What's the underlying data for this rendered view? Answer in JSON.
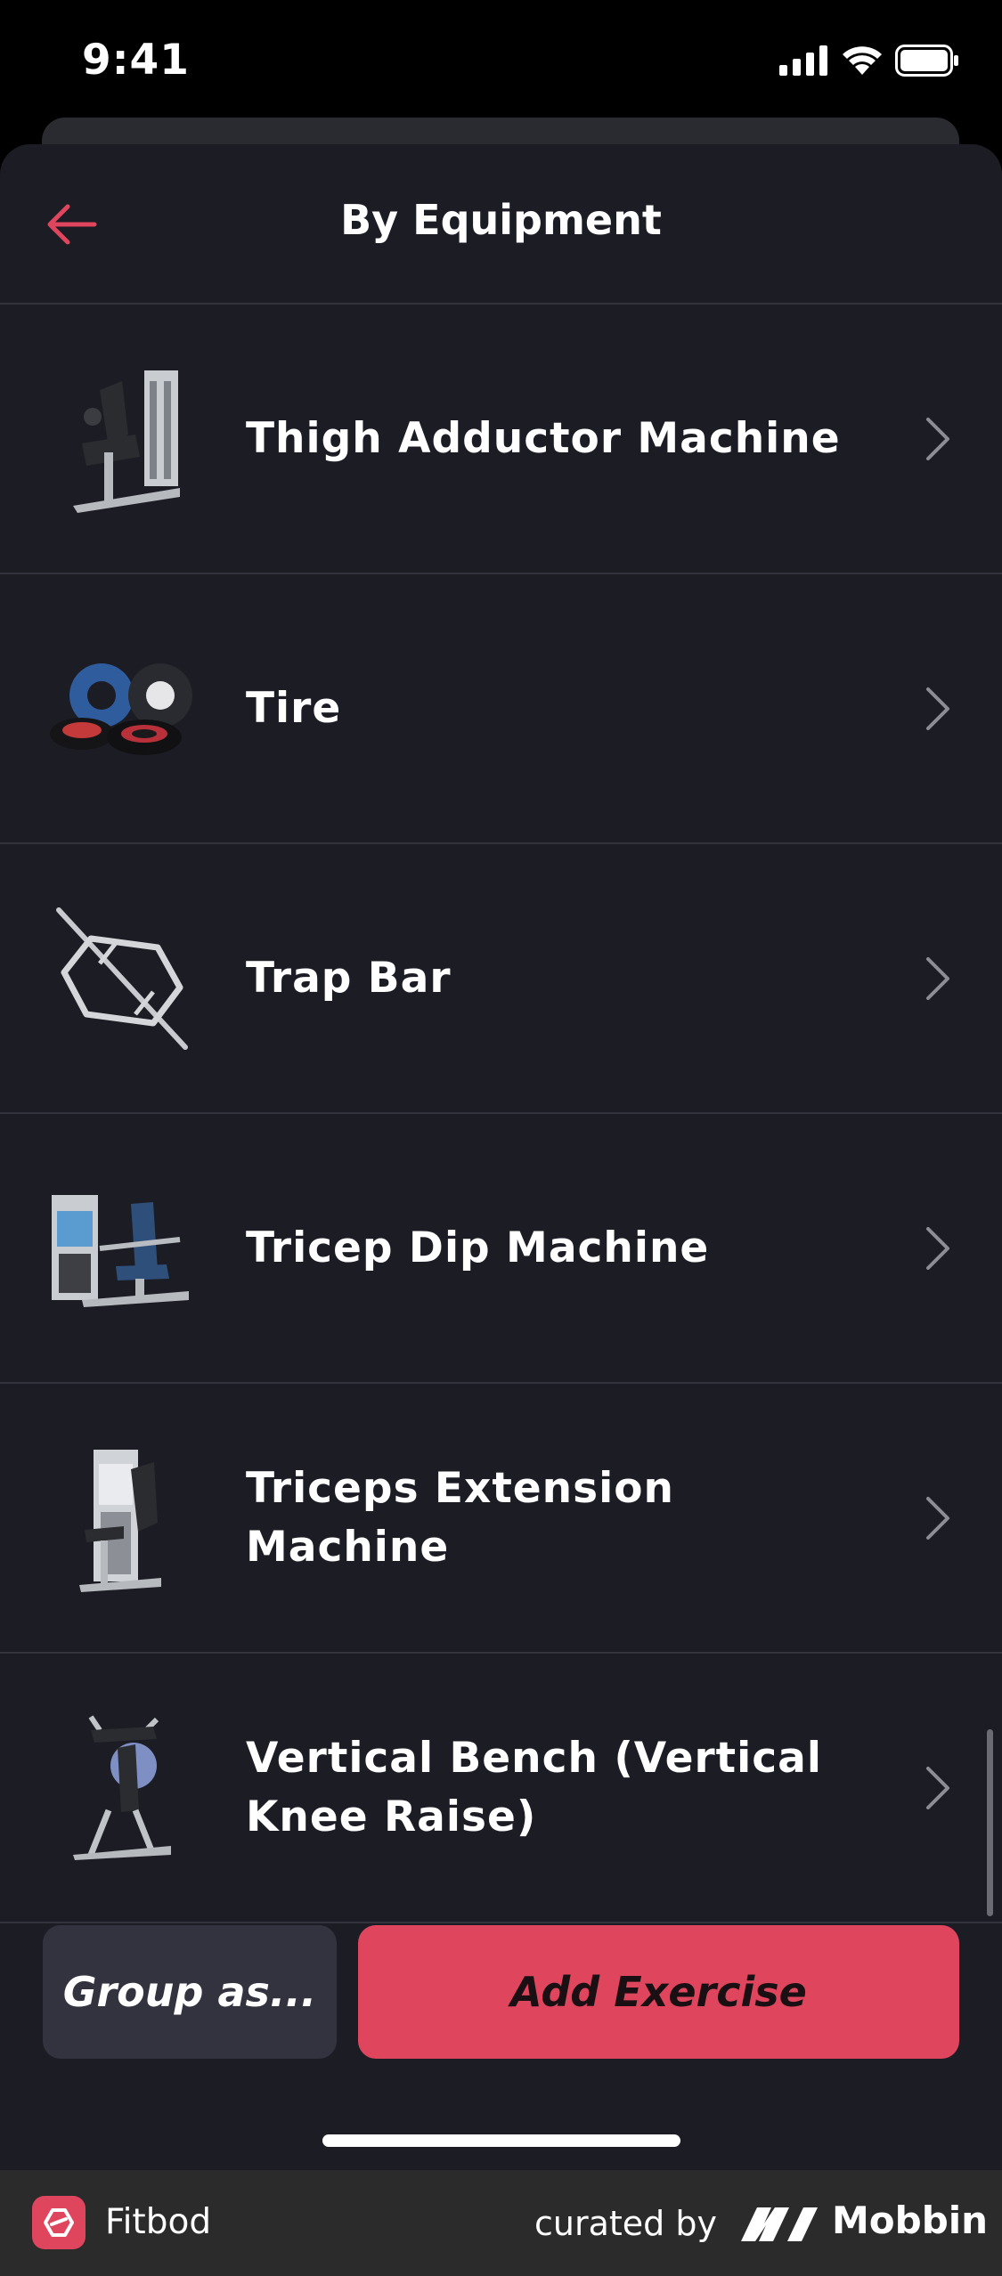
{
  "status_bar": {
    "time": "9:41"
  },
  "header": {
    "title": "By Equipment",
    "back_icon": "arrow-left-icon"
  },
  "list": {
    "items": [
      {
        "label": "Thigh Adductor Machine",
        "icon": "thigh-adductor-machine-thumbnail"
      },
      {
        "label": "Tire",
        "icon": "tire-thumbnail"
      },
      {
        "label": "Trap Bar",
        "icon": "trap-bar-thumbnail"
      },
      {
        "label": "Tricep Dip Machine",
        "icon": "tricep-dip-machine-thumbnail"
      },
      {
        "label": "Triceps Extension Machine",
        "icon": "triceps-extension-machine-thumbnail"
      },
      {
        "label": "Vertical Bench (Vertical Knee Raise)",
        "icon": "vertical-bench-thumbnail"
      }
    ]
  },
  "actions": {
    "group_label": "Group as...",
    "add_label": "Add Exercise"
  },
  "footer": {
    "app_name": "Fitbod",
    "curated_by": "curated by",
    "brand": "Mobbin"
  },
  "colors": {
    "accent": "#e0455e",
    "background": "#1c1c25",
    "divider": "#33333d",
    "text": "#ffffff"
  }
}
